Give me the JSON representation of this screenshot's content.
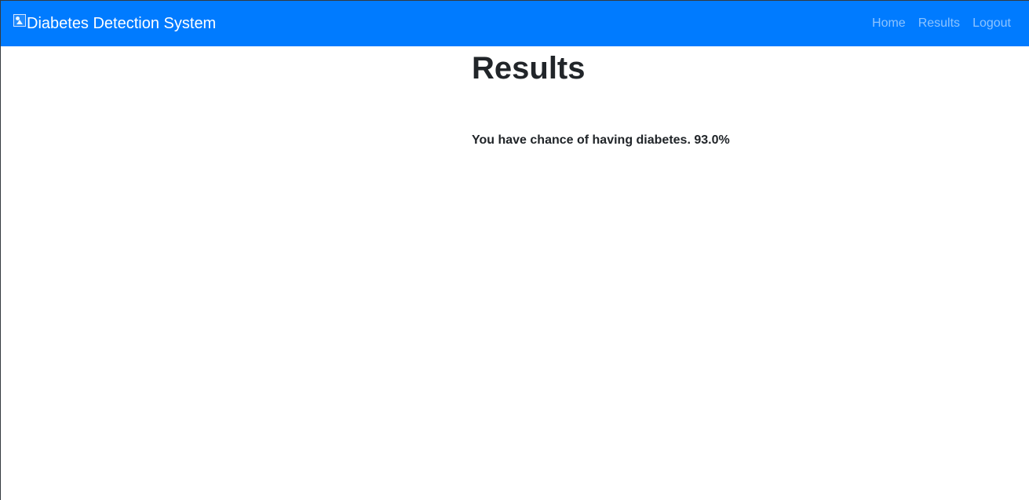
{
  "navbar": {
    "brand_text": "Diabetes Detection System",
    "brand_icon": "broken-image-icon",
    "background_color": "#007bff",
    "links": [
      {
        "label": "Home"
      },
      {
        "label": "Results"
      },
      {
        "label": "Logout"
      }
    ]
  },
  "main": {
    "title": "Results",
    "result_prefix": "You have chance of having diabetes.",
    "result_value": "93.0%"
  }
}
